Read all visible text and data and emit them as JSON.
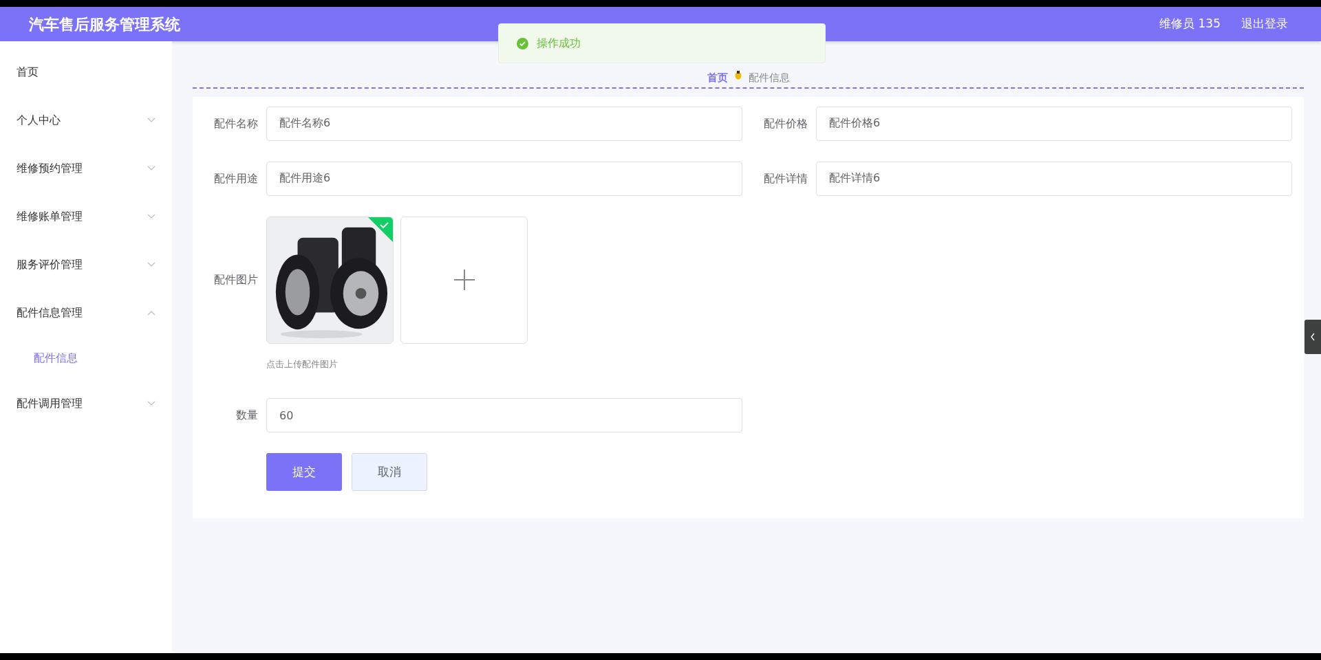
{
  "header": {
    "title": "汽车售后服务管理系统",
    "user": "维修员 135",
    "logout": "退出登录"
  },
  "toast": {
    "message": "操作成功"
  },
  "sidebar": {
    "items": [
      {
        "label": "首页"
      },
      {
        "label": "个人中心",
        "expanded": false
      },
      {
        "label": "维修预约管理",
        "expanded": false
      },
      {
        "label": "维修账单管理",
        "expanded": false
      },
      {
        "label": "服务评价管理",
        "expanded": false
      },
      {
        "label": "配件信息管理",
        "expanded": true,
        "children": [
          {
            "label": "配件信息",
            "selected": true
          }
        ]
      },
      {
        "label": "配件调用管理",
        "expanded": false
      }
    ]
  },
  "breadcrumb": [
    "首页",
    "配件信息"
  ],
  "form": {
    "fields": [
      {
        "label": "配件名称",
        "value": "配件名称6"
      },
      {
        "label": "配件价格",
        "value": "配件价格6"
      },
      {
        "label": "配件用途",
        "value": "配件用途6"
      },
      {
        "label": "配件详情",
        "value": "配件详情6"
      }
    ],
    "image": {
      "label": "配件图片",
      "uploaded": true,
      "hint": "点击上传配件图片"
    },
    "quantity": {
      "label": "数量",
      "value": "60"
    },
    "buttons": [
      {
        "label": "提交",
        "kind": "primary"
      },
      {
        "label": "取消",
        "kind": "secondary"
      }
    ]
  }
}
